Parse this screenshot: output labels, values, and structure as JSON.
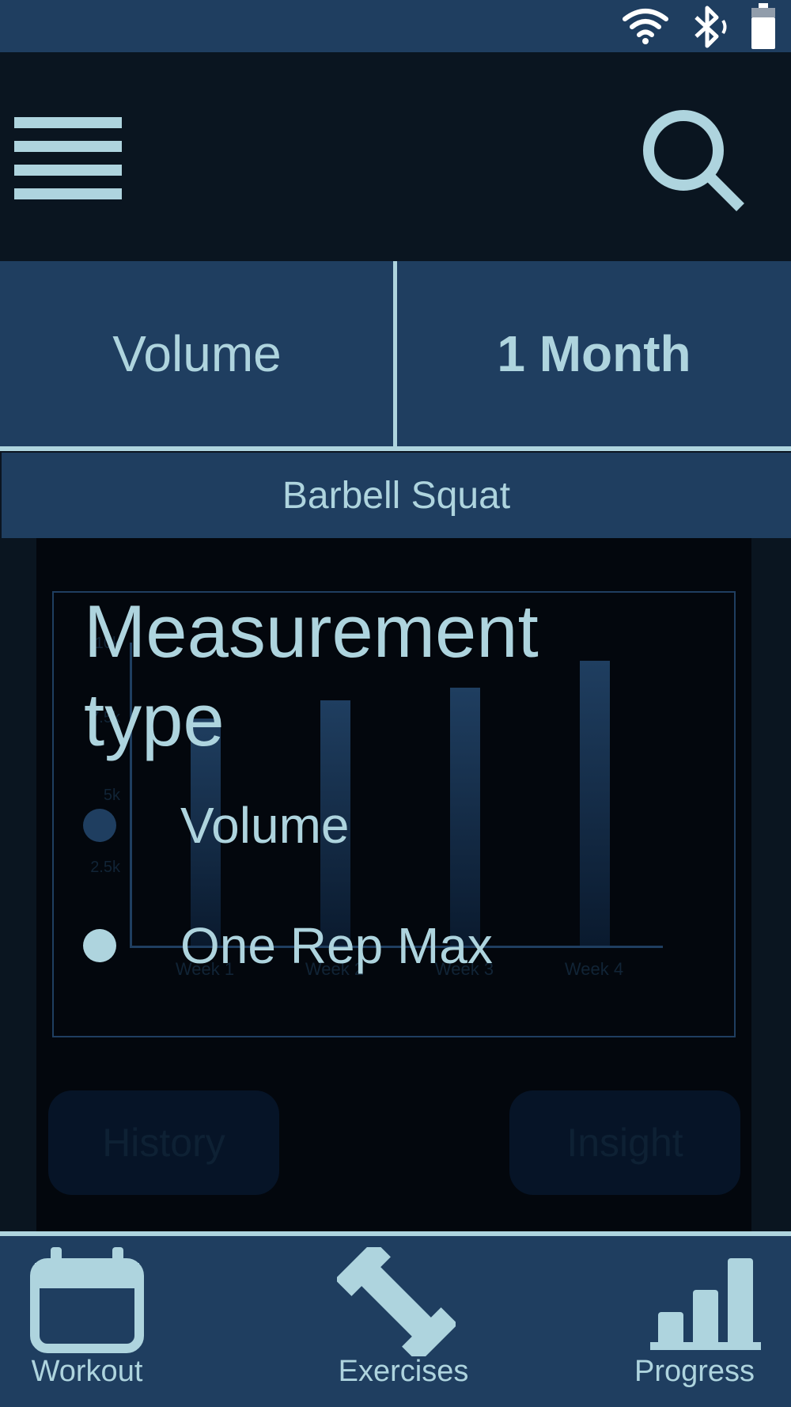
{
  "status_bar": {
    "icons": [
      "wifi-icon",
      "bluetooth-icon",
      "battery-icon"
    ]
  },
  "app_bar": {
    "menu_icon": "hamburger-menu-icon",
    "search_icon": "search-icon"
  },
  "selector": {
    "measurement_label": "Volume",
    "range_label": "1 Month"
  },
  "exercise": {
    "name": "Barbell Squat"
  },
  "chart_data": {
    "type": "bar",
    "categories": [
      "Week 1",
      "Week 2",
      "Week 3",
      "Week 4"
    ],
    "values": [
      7500,
      8100,
      8500,
      9400
    ],
    "ytick_labels": [
      "10k",
      "7.5k",
      "5k",
      "2.5k"
    ],
    "ylim": [
      0,
      10000
    ],
    "grid": false
  },
  "dialog": {
    "title": "Measurement type",
    "options": [
      {
        "label": "Volume",
        "selected": true
      },
      {
        "label": "One Rep Max",
        "selected": false
      }
    ]
  },
  "actions": {
    "history_label": "History",
    "insight_label": "Insight"
  },
  "bottom_nav": {
    "items": [
      {
        "label": "Workout",
        "icon": "calendar-icon"
      },
      {
        "label": "Exercises",
        "icon": "dumbbell-icon"
      },
      {
        "label": "Progress",
        "icon": "bar-chart-icon"
      }
    ]
  },
  "colors": {
    "primary": "#1f3e60",
    "accent": "#aed4de",
    "background": "#0a1520"
  }
}
